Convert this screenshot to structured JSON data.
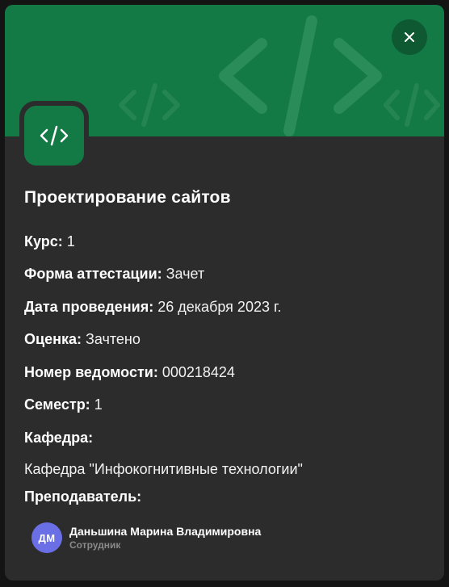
{
  "course": {
    "title": "Проектирование сайтов",
    "icon": "code-icon"
  },
  "close": {
    "icon": "close-icon",
    "label": "×"
  },
  "fields": {
    "kurs": {
      "label": "Курс:",
      "value": "1"
    },
    "forma": {
      "label": "Форма аттестации:",
      "value": "Зачет"
    },
    "data": {
      "label": "Дата проведения:",
      "value": "26 декабря 2023 г."
    },
    "ocenka": {
      "label": "Оценка:",
      "value": "Зачтено"
    },
    "vedomost": {
      "label": "Номер ведомости:",
      "value": "000218424"
    },
    "semestr": {
      "label": "Семестр:",
      "value": "1"
    },
    "kafedra": {
      "label": "Кафедра:",
      "value": "Кафедра \"Инфокогнитивные технологии\""
    },
    "prepodavatel": {
      "label": "Преподаватель:"
    }
  },
  "teacher": {
    "initials": "ДМ",
    "name": "Даньшина Марина Владимировна",
    "role": "Сотрудник"
  },
  "colors": {
    "accent": "#137a46",
    "background": "#2c2c2c",
    "avatar": "#6b6fe6"
  }
}
